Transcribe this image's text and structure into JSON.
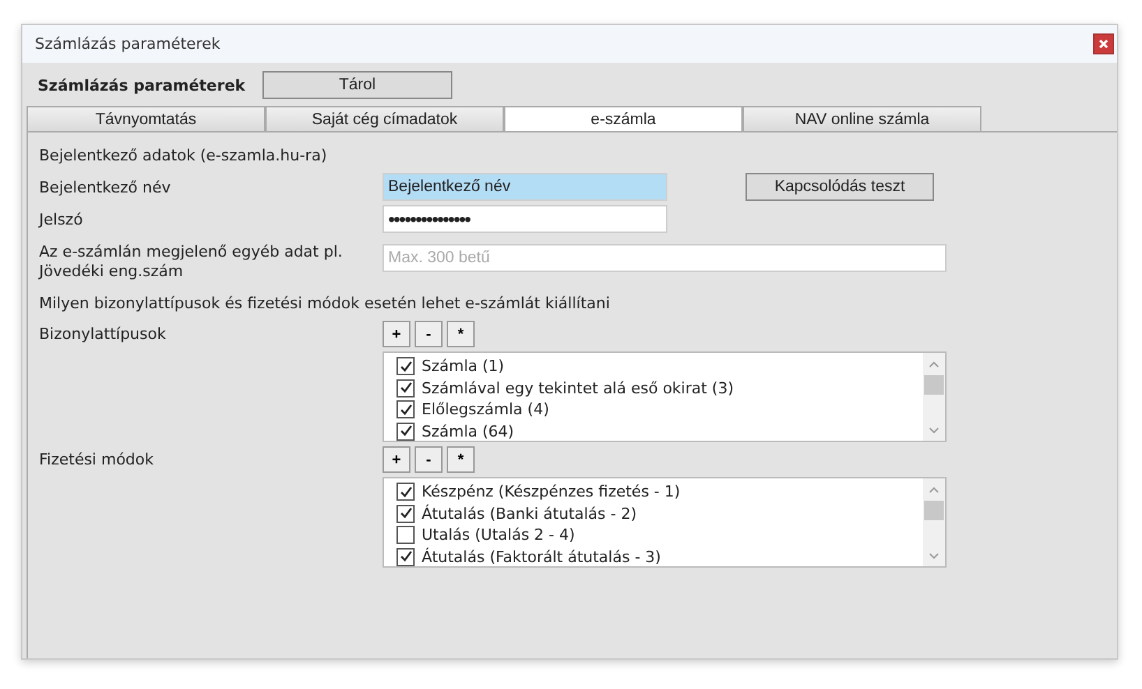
{
  "window": {
    "title": "Számlázás paraméterek"
  },
  "header": {
    "title": "Számlázás paraméterek",
    "save_button": "Tárol"
  },
  "tabs": [
    {
      "label": "Távnyomtatás",
      "selected": false
    },
    {
      "label": "Saját cég címadatok",
      "selected": false
    },
    {
      "label": "e-számla",
      "selected": true
    },
    {
      "label": "NAV online számla",
      "selected": false
    }
  ],
  "login_section": {
    "heading": "Bejelentkező adatok  (e-szamla.hu-ra)",
    "username": {
      "label": "Bejelentkező név",
      "value": "Bejelentkező név",
      "highlighted": true
    },
    "password": {
      "label": "Jelszó",
      "value": "•••••••••••••••"
    },
    "test_button": "Kapcsolódás teszt",
    "extra": {
      "label": "Az e-számlán megjelenő egyéb adat pl. Jövedéki eng.szám",
      "placeholder": "Max. 300 betű"
    }
  },
  "question": "Milyen bizonylattípusok és fizetési módok esetén lehet e-számlát kiállítani",
  "lists": [
    {
      "label": "Bizonylattípusok",
      "buttons": [
        "+",
        "-",
        "*"
      ],
      "items": [
        {
          "label": "Számla (1)",
          "checked": true
        },
        {
          "label": "Számlával egy tekintet alá eső okirat (3)",
          "checked": true
        },
        {
          "label": "Előlegszámla (4)",
          "checked": true
        },
        {
          "label": "Számla (64)",
          "checked": true
        }
      ]
    },
    {
      "label": "Fizetési módok",
      "buttons": [
        "+",
        "-",
        "*"
      ],
      "items": [
        {
          "label": "Készpénz (Készpénzes fizetés - 1)",
          "checked": true
        },
        {
          "label": "Átutalás (Banki átutalás - 2)",
          "checked": true
        },
        {
          "label": "Utalás (Utalás 2 - 4)",
          "checked": false
        },
        {
          "label": "Átutalás (Faktorált átutalás - 3)",
          "checked": true
        }
      ]
    }
  ]
}
